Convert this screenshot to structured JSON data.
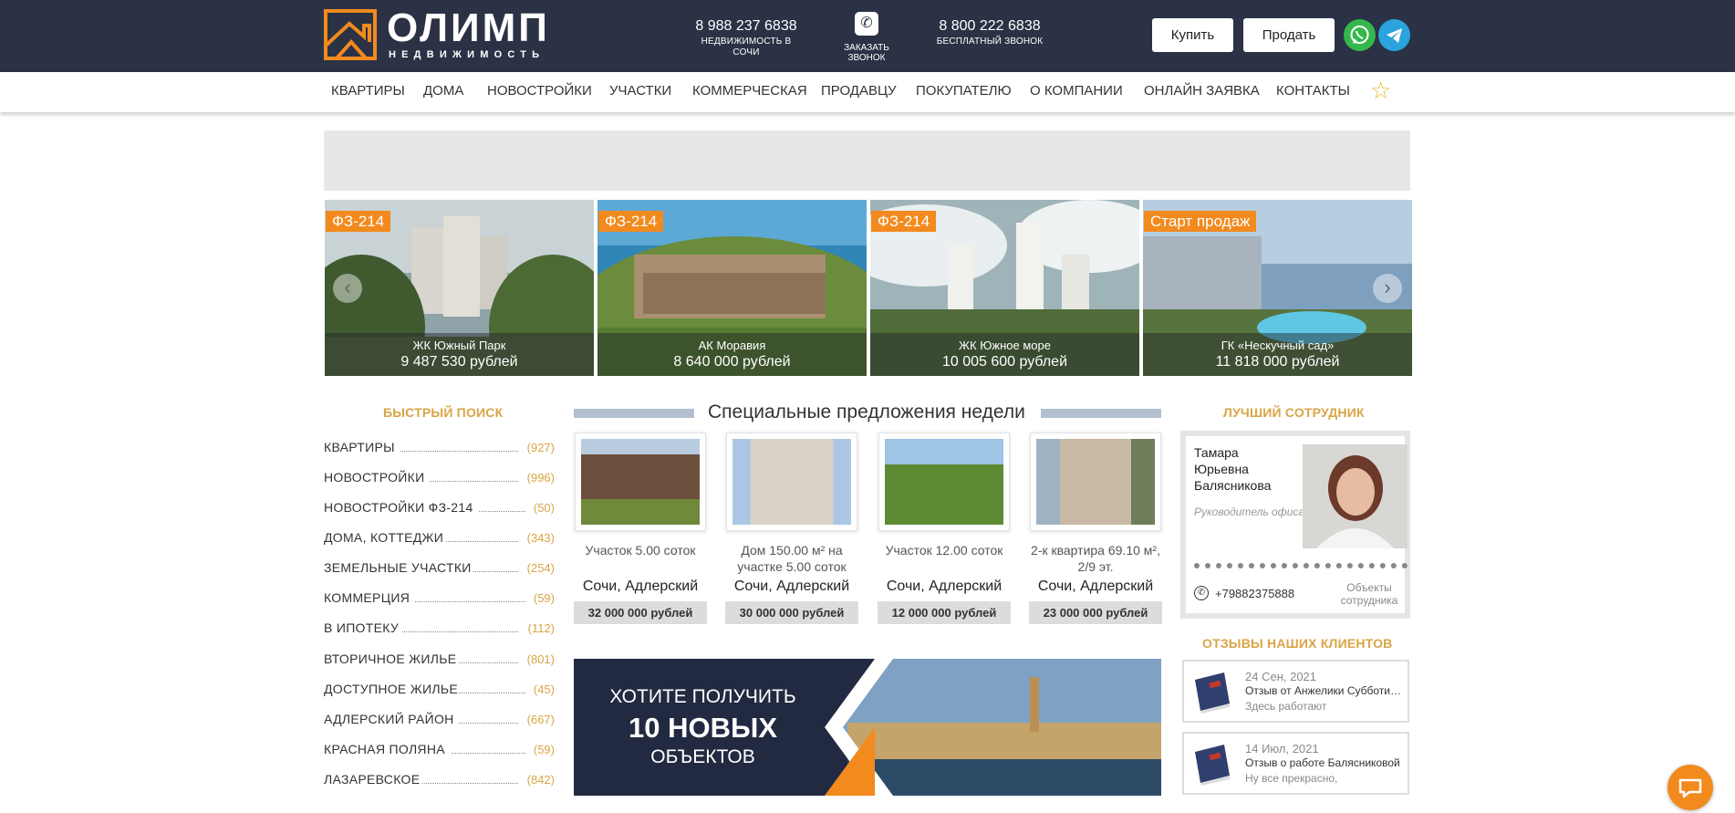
{
  "header": {
    "logo_word": "ОЛИМП",
    "logo_sub": "НЕДВИЖИМОСТЬ",
    "phone1": {
      "number": "8 988 237 6838",
      "caption": "НЕДВИЖИМОСТЬ В СОЧИ"
    },
    "callback": {
      "caption": "ЗАКАЗАТЬ ЗВОНОК",
      "icon": "phone-icon"
    },
    "phone2": {
      "number": "8 800 222 6838",
      "caption": "БЕСПЛАТНЫЙ ЗВОНОК"
    },
    "buy_label": "Купить",
    "sell_label": "Продать",
    "whatsapp_icon": "whatsapp-icon",
    "telegram_icon": "telegram-icon"
  },
  "nav": {
    "items": [
      "КВАРТИРЫ",
      "ДОМА",
      "НОВОСТРОЙКИ",
      "УЧАСТКИ",
      "КОММЕРЧЕСКАЯ",
      "ПРОДАВЦУ",
      "ПОКУПАТЕЛЮ",
      "О КОМПАНИИ",
      "ОНЛАЙН ЗАЯВКА",
      "КОНТАКТЫ"
    ],
    "favorites_icon": "star-icon"
  },
  "slider": {
    "slides": [
      {
        "badge": "ФЗ-214",
        "name": "ЖК Южный Парк",
        "price": "9 487 530 рублей"
      },
      {
        "badge": "ФЗ-214",
        "name": "АК Моравия",
        "price": "8 640 000 рублей"
      },
      {
        "badge": "ФЗ-214",
        "name": "ЖК Южное море",
        "price": "10 005 600 рублей"
      },
      {
        "badge": "Старт продаж",
        "name": "ГК «Нескучный сад»",
        "price": "11 818 000 рублей"
      }
    ],
    "prev": "‹",
    "next": "›"
  },
  "quick_search": {
    "title": "БЫСТРЫЙ ПОИСК",
    "items": [
      {
        "label": "КВАРТИРЫ",
        "count": "(927)"
      },
      {
        "label": "НОВОСТРОЙКИ",
        "count": "(996)"
      },
      {
        "label": "НОВОСТРОЙКИ ФЗ-214",
        "count": "(50)"
      },
      {
        "label": "ДОМА, КОТТЕДЖИ",
        "count": "(343)"
      },
      {
        "label": "ЗЕМЕЛЬНЫЕ УЧАСТКИ",
        "count": "(254)"
      },
      {
        "label": "КОММЕРЦИЯ",
        "count": "(59)"
      },
      {
        "label": "В ИПОТЕКУ",
        "count": "(112)"
      },
      {
        "label": "ВТОРИЧНОЕ ЖИЛЬЕ",
        "count": "(801)"
      },
      {
        "label": "ДОСТУПНОЕ ЖИЛЬЕ",
        "count": "(45)"
      },
      {
        "label": "АДЛЕРСКИЙ РАЙОН",
        "count": "(667)"
      },
      {
        "label": "КРАСНАЯ ПОЛЯНА",
        "count": "(59)"
      },
      {
        "label": "ЛАЗАРЕВСКОЕ",
        "count": "(842)"
      }
    ]
  },
  "special_offers": {
    "title": "Специальные предложения недели",
    "items": [
      {
        "desc": "Участок 5.00 соток",
        "city": "Сочи, Адлерский",
        "price": "32 000 000 рублей"
      },
      {
        "desc": "Дом 150.00 м² на участке 5.00 соток",
        "city": "Сочи, Адлерский",
        "price": "30 000 000 рублей"
      },
      {
        "desc": "Участок 12.00 соток",
        "city": "Сочи, Адлерский",
        "price": "12 000 000 рублей"
      },
      {
        "desc": "2-к квартира 69.10 м², 2/9 эт.",
        "city": "Сочи, Адлерский",
        "price": "23 000 000 рублей"
      }
    ]
  },
  "banner": {
    "line1": "ХОТИТЕ ПОЛУЧИТЬ",
    "line2": "10 НОВЫХ",
    "line3": "ОБЪЕКТОВ"
  },
  "best_employee": {
    "title": "ЛУЧШИЙ СОТРУДНИК",
    "name": "Тамара Юрьевна Балясникова",
    "role": "Руководитель офиса Адлер",
    "phone": "+79882375888",
    "objects_link": "Объекты сотрудника"
  },
  "reviews": {
    "title": "ОТЗЫВЫ НАШИХ КЛИЕНТОВ",
    "items": [
      {
        "date": "24 Сен, 2021",
        "title": "Отзыв от Анжелики Субботиной",
        "excerpt": "Здесь работают"
      },
      {
        "date": "14 Июл, 2021",
        "title": "Отзыв о работе Балясниковой",
        "excerpt": "Ну все прекрасно,"
      }
    ]
  },
  "colors": {
    "header_bg": "#2b3245",
    "accent_orange": "#f28a1e",
    "accent_gold": "#d9a545"
  }
}
